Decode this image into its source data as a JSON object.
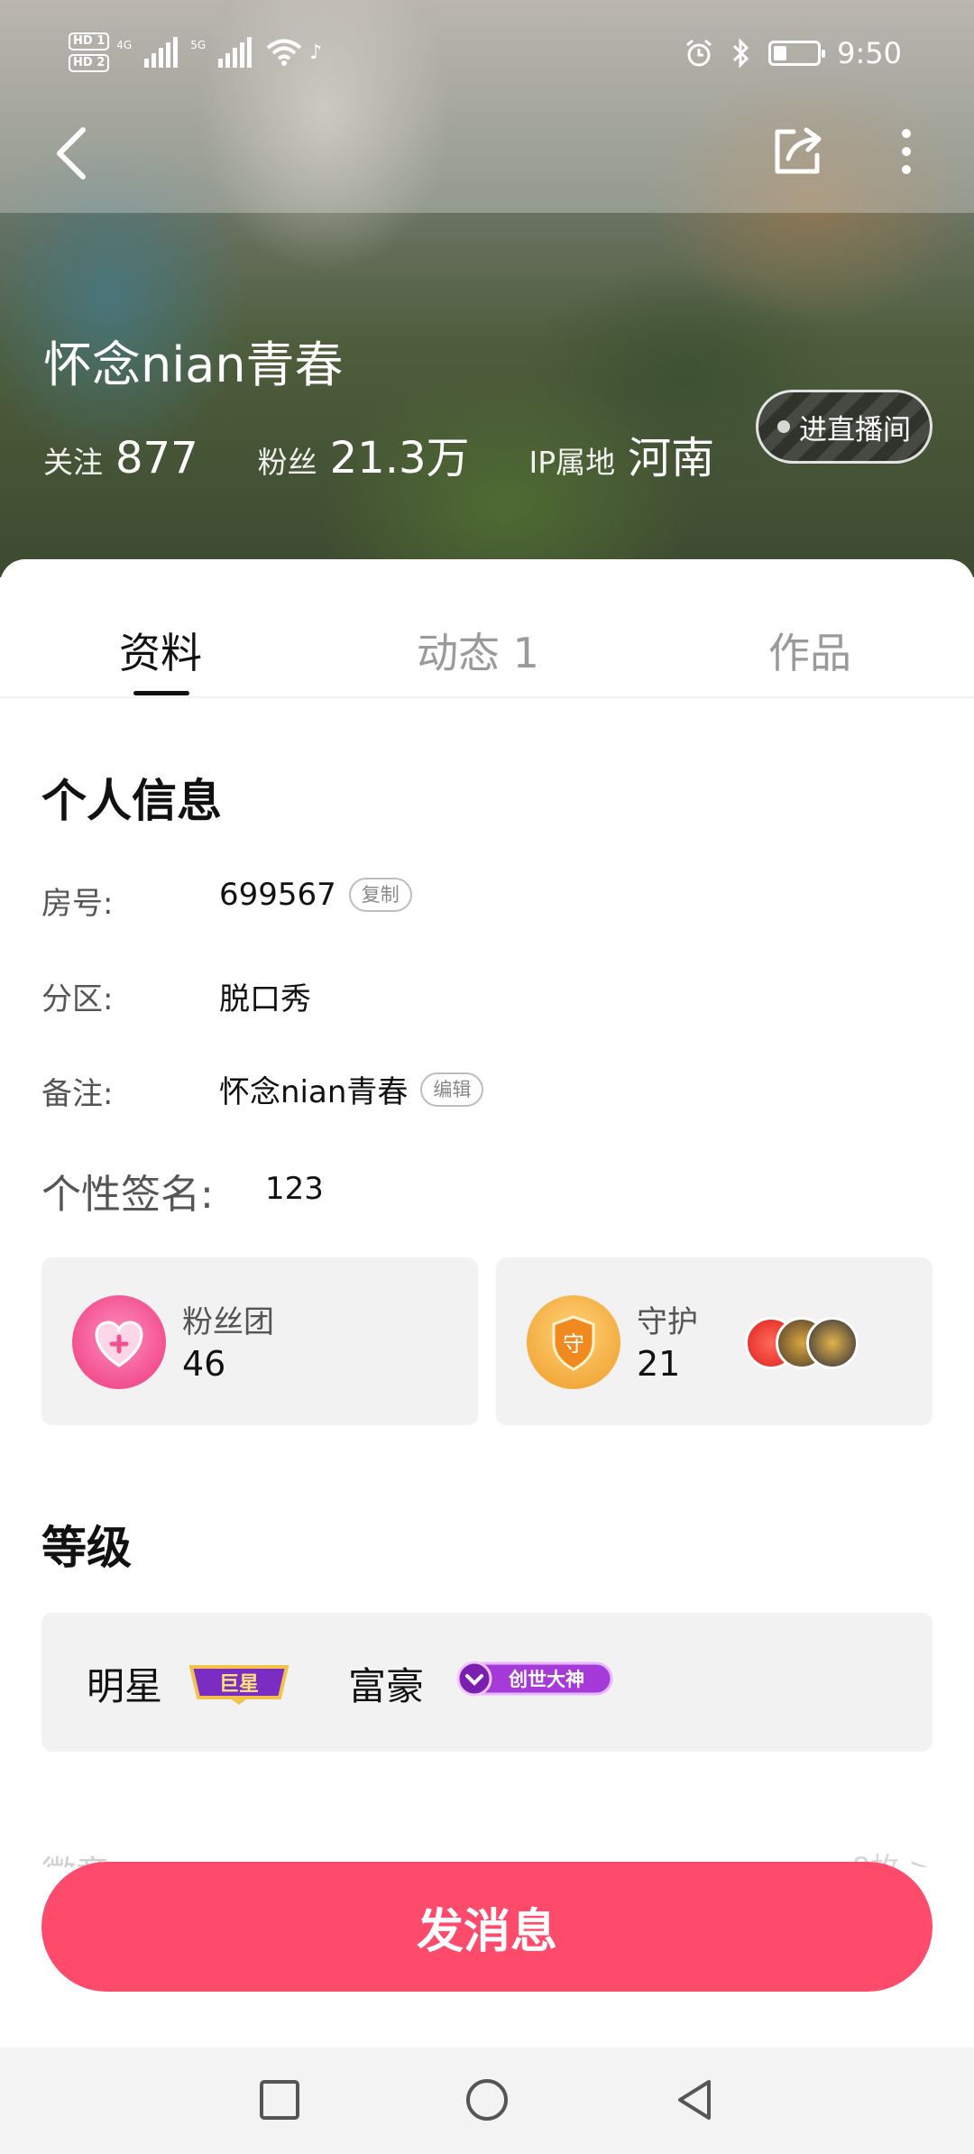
{
  "status_bar": {
    "hd_top": "HD 1",
    "hd_bottom": "HD 2",
    "net1": "4G",
    "net2": "5G",
    "time": "9:50"
  },
  "profile": {
    "name": "怀念nian青春",
    "following_label": "关注",
    "following_value": "877",
    "fans_label": "粉丝",
    "fans_value": "21.3万",
    "ip_label": "IP属地",
    "ip_value": "河南",
    "live_button": "进直播间"
  },
  "tabs": [
    {
      "label": "资料",
      "active": true
    },
    {
      "label": "动态 1",
      "active": false
    },
    {
      "label": "作品",
      "active": false
    }
  ],
  "personal_info": {
    "title": "个人信息",
    "room_label": "房号:",
    "room_value": "699567",
    "copy_label": "复制",
    "zone_label": "分区:",
    "zone_value": "脱口秀",
    "note_label": "备注:",
    "note_value": "怀念nian青春",
    "edit_label": "编辑",
    "signature_label": "个性签名:",
    "signature_value": "123"
  },
  "cards": {
    "fan_club_label": "粉丝团",
    "fan_club_count": "46",
    "guard_label": "守护",
    "guard_count": "21",
    "guard_icon_char": "守"
  },
  "level": {
    "title": "等级",
    "star_label": "明星",
    "star_badge": "巨星",
    "rich_label": "富豪",
    "rich_badge": "创世大神"
  },
  "cut_row": {
    "left": "徽章",
    "right": "8枚 >"
  },
  "send_button": "发消息",
  "colors": {
    "accent": "#fe4a6b",
    "card_bg": "#f2f2f2",
    "fan_club_icon": "#f2508f",
    "guard_icon": "#f2a93a"
  }
}
